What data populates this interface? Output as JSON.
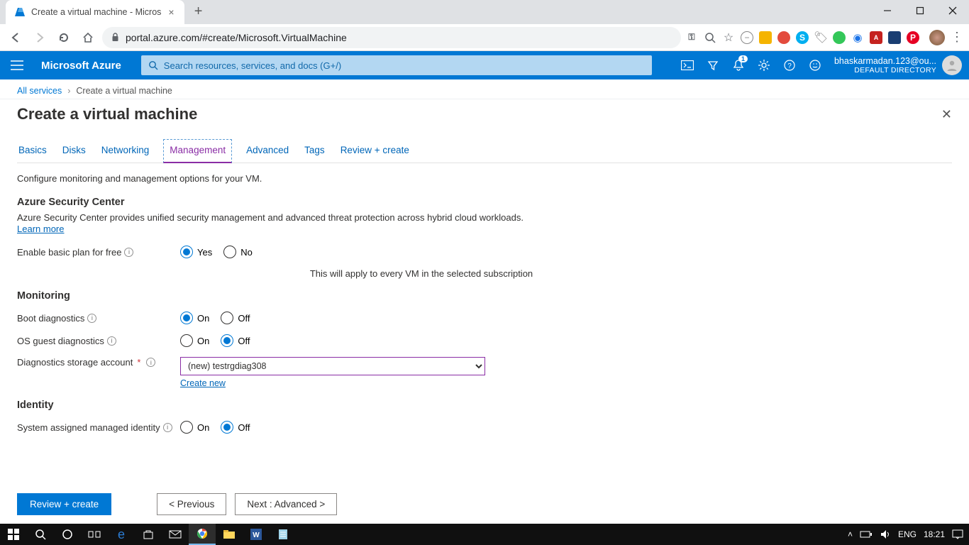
{
  "browser": {
    "tab_title": "Create a virtual machine - Micros",
    "url": "portal.azure.com/#create/Microsoft.VirtualMachine"
  },
  "azure_header": {
    "brand": "Microsoft Azure",
    "search_placeholder": "Search resources, services, and docs (G+/)",
    "notifications_badge": "1",
    "user_line1": "bhaskarmadan.123@ou...",
    "user_line2": "DEFAULT DIRECTORY"
  },
  "breadcrumb": {
    "root": "All services",
    "current": "Create a virtual machine"
  },
  "blade": {
    "title": "Create a virtual machine",
    "tabs": [
      "Basics",
      "Disks",
      "Networking",
      "Management",
      "Advanced",
      "Tags",
      "Review + create"
    ],
    "active_tab_index": 3,
    "intro": "Configure monitoring and management options for your VM.",
    "security": {
      "heading": "Azure Security Center",
      "desc": "Azure Security Center provides unified security management and advanced threat protection across hybrid cloud workloads.",
      "learn_more": "Learn more",
      "enable_label": "Enable basic plan for free",
      "opt_yes": "Yes",
      "opt_no": "No",
      "enable_selected": "Yes",
      "note": "This will apply to every VM in the selected subscription"
    },
    "monitoring": {
      "heading": "Monitoring",
      "boot_label": "Boot diagnostics",
      "boot_selected": "On",
      "os_label": "OS guest diagnostics",
      "os_selected": "Off",
      "storage_label": "Diagnostics storage account",
      "storage_value": "(new) testrgdiag308",
      "create_new": "Create new",
      "opt_on": "On",
      "opt_off": "Off"
    },
    "identity": {
      "heading": "Identity",
      "sys_label": "System assigned managed identity",
      "sys_selected": "Off",
      "opt_on": "On",
      "opt_off": "Off"
    },
    "footer": {
      "review": "Review + create",
      "prev": "< Previous",
      "next": "Next : Advanced >"
    }
  },
  "taskbar": {
    "lang": "ENG",
    "time": "18:21"
  }
}
